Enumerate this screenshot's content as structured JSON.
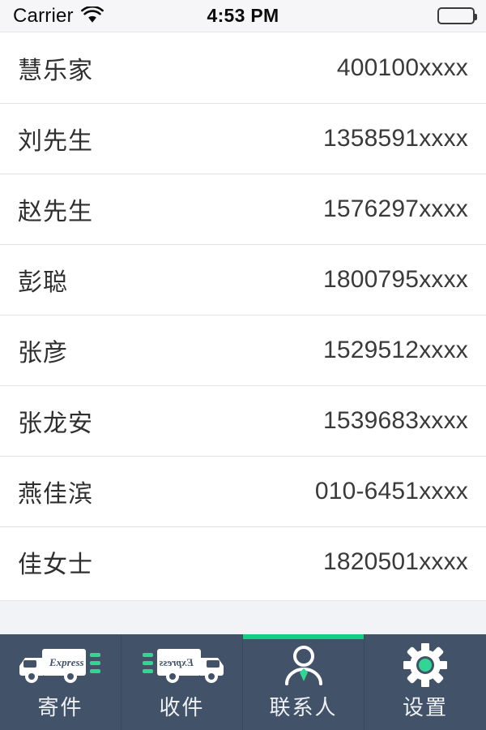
{
  "status_bar": {
    "carrier": "Carrier",
    "time": "4:53 PM",
    "wifi_icon": "wifi-icon",
    "battery_icon": "battery-full-icon"
  },
  "contacts": {
    "rows": [
      {
        "name": "慧乐家",
        "phone": "400100xxxx"
      },
      {
        "name": "刘先生",
        "phone": "1358591xxxx"
      },
      {
        "name": "赵先生",
        "phone": "1576297xxxx"
      },
      {
        "name": "彭聪",
        "phone": "1800795xxxx"
      },
      {
        "name": "张彦",
        "phone": "1529512xxxx"
      },
      {
        "name": "张龙安",
        "phone": "1539683xxxx"
      },
      {
        "name": "燕佳滨",
        "phone": "010-6451xxxx"
      },
      {
        "name": "佳女士",
        "phone": "1820501xxxx"
      }
    ]
  },
  "tabbar": {
    "active_index": 2,
    "accent_color": "#16cd84",
    "background_color": "#425268",
    "tabs": [
      {
        "label": "寄件",
        "icon": "truck-send-icon",
        "icon_badge_text": "Express"
      },
      {
        "label": "收件",
        "icon": "truck-receive-icon",
        "icon_badge_text": "Express"
      },
      {
        "label": "联系人",
        "icon": "person-icon",
        "icon_badge_text": ""
      },
      {
        "label": "设置",
        "icon": "gear-icon",
        "icon_badge_text": ""
      }
    ]
  }
}
